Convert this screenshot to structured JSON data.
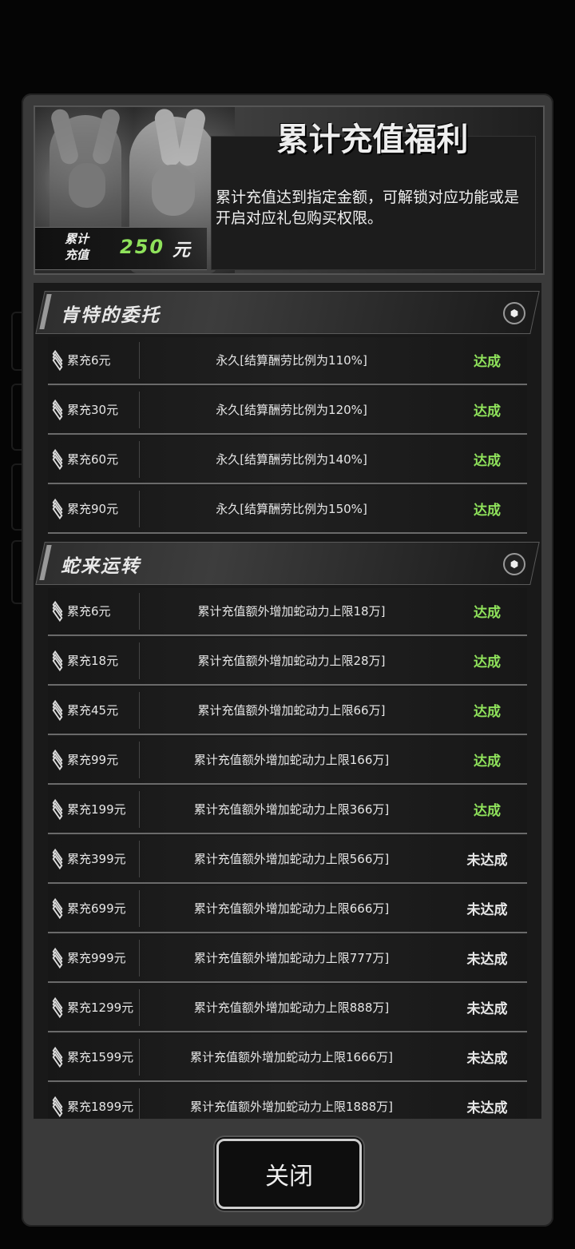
{
  "header": {
    "title": "累计充值福利",
    "description": "累计充值达到指定金额，可解锁对应功能或是开启对应礼包购买权限。",
    "accum_label_line1": "累计",
    "accum_label_line2": "充值",
    "accum_amount": "250",
    "accum_unit": "元"
  },
  "sections": [
    {
      "name": "肯特的委托",
      "rows": [
        {
          "cond": "累充6元",
          "reward": "永久[结算酬劳比例为110%]",
          "status": "达成",
          "done": true
        },
        {
          "cond": "累充30元",
          "reward": "永久[结算酬劳比例为120%]",
          "status": "达成",
          "done": true
        },
        {
          "cond": "累充60元",
          "reward": "永久[结算酬劳比例为140%]",
          "status": "达成",
          "done": true
        },
        {
          "cond": "累充90元",
          "reward": "永久[结算酬劳比例为150%]",
          "status": "达成",
          "done": true
        }
      ]
    },
    {
      "name": "蛇来运转",
      "rows": [
        {
          "cond": "累充6元",
          "reward": "累计充值额外增加蛇动力上限18万]",
          "status": "达成",
          "done": true
        },
        {
          "cond": "累充18元",
          "reward": "累计充值额外增加蛇动力上限28万]",
          "status": "达成",
          "done": true
        },
        {
          "cond": "累充45元",
          "reward": "累计充值额外增加蛇动力上限66万]",
          "status": "达成",
          "done": true
        },
        {
          "cond": "累充99元",
          "reward": "累计充值额外增加蛇动力上限166万]",
          "status": "达成",
          "done": true
        },
        {
          "cond": "累充199元",
          "reward": "累计充值额外增加蛇动力上限366万]",
          "status": "达成",
          "done": true
        },
        {
          "cond": "累充399元",
          "reward": "累计充值额外增加蛇动力上限566万]",
          "status": "未达成",
          "done": false
        },
        {
          "cond": "累充699元",
          "reward": "累计充值额外增加蛇动力上限666万]",
          "status": "未达成",
          "done": false
        },
        {
          "cond": "累充999元",
          "reward": "累计充值额外增加蛇动力上限777万]",
          "status": "未达成",
          "done": false
        },
        {
          "cond": "累充1299元",
          "reward": "累计充值额外增加蛇动力上限888万]",
          "status": "未达成",
          "done": false
        },
        {
          "cond": "累充1599元",
          "reward": "累计充值额外增加蛇动力上限1666万]",
          "status": "未达成",
          "done": false
        },
        {
          "cond": "累充1899元",
          "reward": "累计充值额外增加蛇动力上限1888万]",
          "status": "未达成",
          "done": false
        }
      ]
    }
  ],
  "close_label": "关闭",
  "colors": {
    "done": "#8fe25b",
    "todo": "#e8e8e8",
    "amount": "#8fe25b"
  }
}
